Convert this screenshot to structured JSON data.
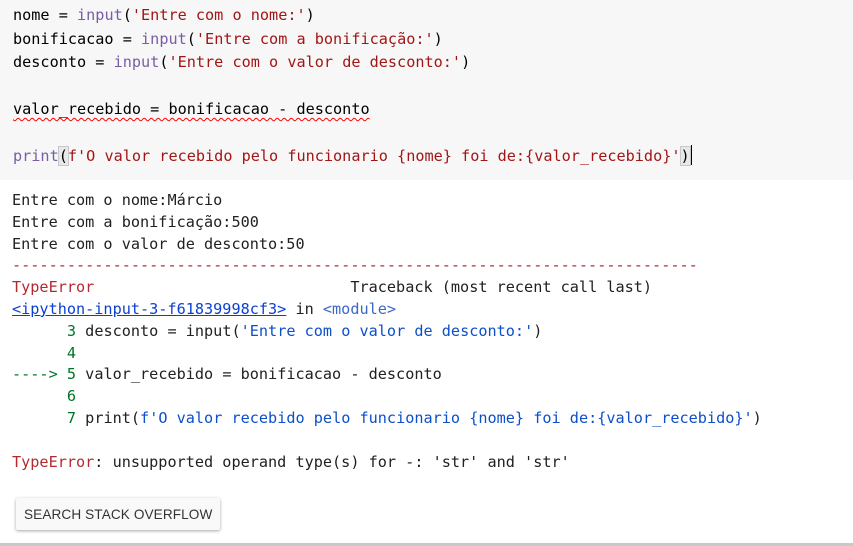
{
  "code_cell": {
    "lines": [
      {
        "var": "nome",
        "op": " = ",
        "fn": "input",
        "open": "(",
        "str": "'Entre com o nome:'",
        "close": ")"
      },
      {
        "var": "bonificacao",
        "op": " = ",
        "fn": "input",
        "open": "(",
        "str": "'Entre com a bonificação:'",
        "close": ")"
      },
      {
        "var": "desconto",
        "op": " = ",
        "fn": "input",
        "open": "(",
        "str": "'Entre com o valor de desconto:'",
        "close": ")"
      }
    ],
    "assignment_line": "valor_recebido = bonificacao - desconto",
    "print_fn": "print",
    "print_open": "(",
    "print_str": "f'O valor recebido pelo funcionario {nome} foi de:{valor_recebido}'",
    "print_close": ")"
  },
  "output": {
    "prompts": [
      "Entre com o nome:Márcio",
      "Entre com a bonificação:500",
      "Entre com o valor de desconto:50"
    ],
    "separator": "---------------------------------------------------------------------------",
    "error_type": "TypeError",
    "traceback_label": "Traceback (most recent call last)",
    "input_link": "<ipython-input-3-f61839998cf3>",
    "in_word": " in ",
    "module_text": "<module>",
    "trace_lines": [
      {
        "prefix": "      ",
        "num": "3",
        "text": " desconto = input(",
        "str": "'Entre com o valor de desconto:'",
        "end": ")"
      },
      {
        "prefix": "      ",
        "num": "4",
        "text": "",
        "str": "",
        "end": ""
      },
      {
        "prefix": "----> ",
        "num": "5",
        "text": " valor_recebido = bonificacao - desconto",
        "str": "",
        "end": ""
      },
      {
        "prefix": "      ",
        "num": "6",
        "text": "",
        "str": "",
        "end": ""
      },
      {
        "prefix": "      ",
        "num": "7",
        "text": " print(",
        "str": "f'O valor recebido pelo funcionario {nome} foi de:{valor_recebido}'",
        "end": ")"
      }
    ],
    "final_error_name": "TypeError",
    "final_error_msg": ": unsupported operand type(s) for -: 'str' and 'str'"
  },
  "button": {
    "label": "SEARCH STACK OVERFLOW"
  },
  "colors": {
    "error_red": "#b22b31",
    "line_green": "#007427",
    "string_blue": "#0c4fc9",
    "code_bg": "#f7f7f7"
  }
}
